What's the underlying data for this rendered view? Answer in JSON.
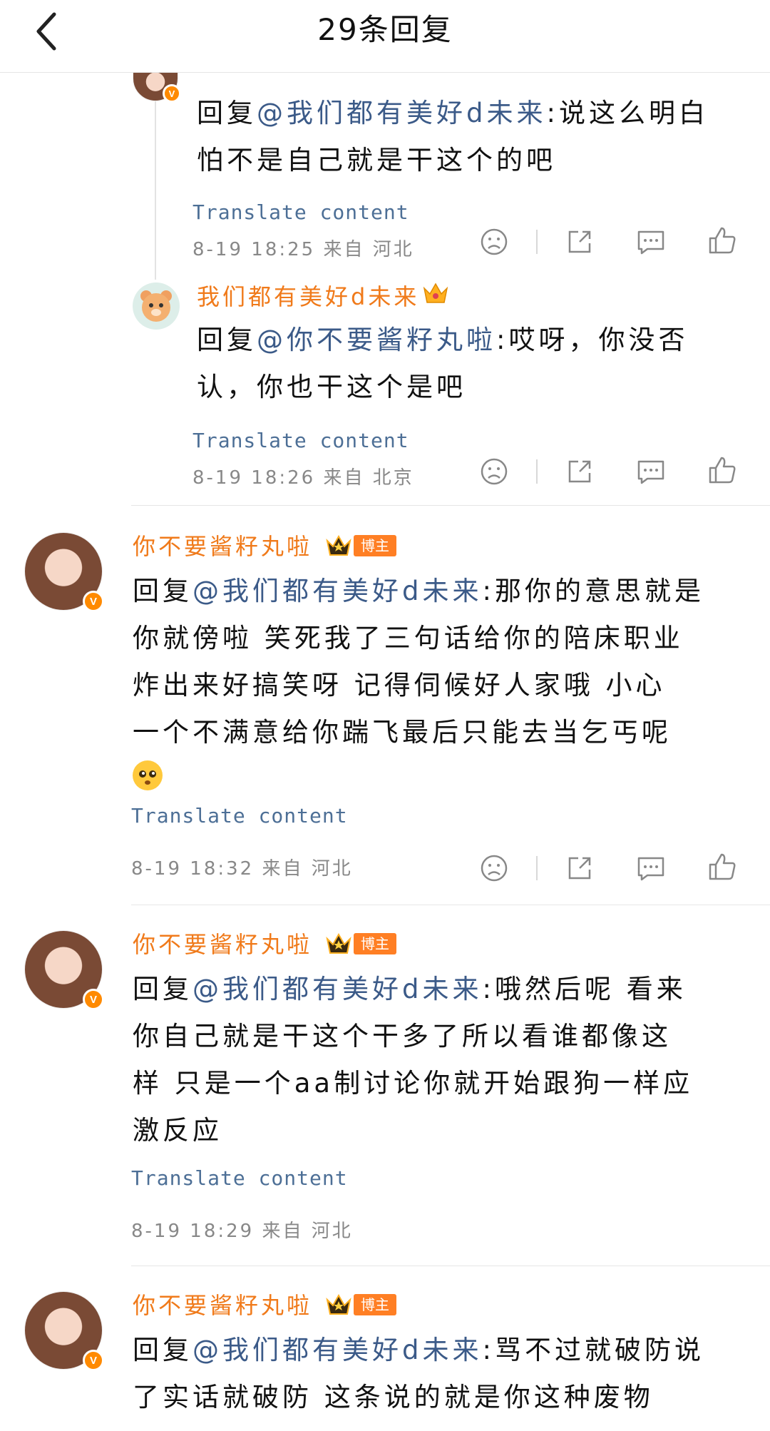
{
  "header": {
    "title": "29条回复"
  },
  "translate_label": "Translate content",
  "comments": [
    {
      "prefix": "回复",
      "mention": "@我们都有美好d未来",
      "text_line1": ":说这么明白",
      "text_line2": "怕不是自己就是干这个的吧",
      "meta": "8-19  18:25  来自  河北"
    },
    {
      "username": "我们都有美好d未来",
      "prefix": "回复",
      "mention": "@你不要酱籽丸啦",
      "text_line1": ":哎呀，你没否",
      "text_line2": "认，你也干这个是吧",
      "meta": "8-19  18:26  来自  北京"
    },
    {
      "username": "你不要酱籽丸啦",
      "badge": "博主",
      "prefix": "回复",
      "mention": "@我们都有美好d未来",
      "text_line1": ":那你的意思就是",
      "text_line2": "你就傍啦 笑死我了三句话给你的陪床职业",
      "text_line3": "炸出来好搞笑呀 记得伺候好人家哦 小心",
      "text_line4": "一个不满意给你踹飞最后只能去当乞丐呢",
      "meta": "8-19  18:32  来自  河北"
    },
    {
      "username": "你不要酱籽丸啦",
      "badge": "博主",
      "prefix": "回复",
      "mention": "@我们都有美好d未来",
      "text_line1": ":哦然后呢 看来",
      "text_line2": "你自己就是干这个干多了所以看谁都像这",
      "text_line3": "样 只是一个aa制讨论你就开始跟狗一样应",
      "text_line4": "激反应",
      "meta": "8-19  18:29  来自  河北"
    },
    {
      "username": "你不要酱籽丸啦",
      "badge": "博主",
      "prefix": "回复",
      "mention": "@我们都有美好d未来",
      "text_line1": ":骂不过就破防说",
      "text_line2": "了实话就破防 这条说的就是你这种废物"
    }
  ],
  "colors": {
    "username": "#f07a1a",
    "mention": "#3b5a88",
    "translate": "#4d6f96",
    "meta": "#888888",
    "badge": "#ff7f24"
  },
  "icons": [
    "back-arrow",
    "dislike-face",
    "share",
    "comment-bubble",
    "thumbs-up",
    "crown",
    "verified-v"
  ]
}
